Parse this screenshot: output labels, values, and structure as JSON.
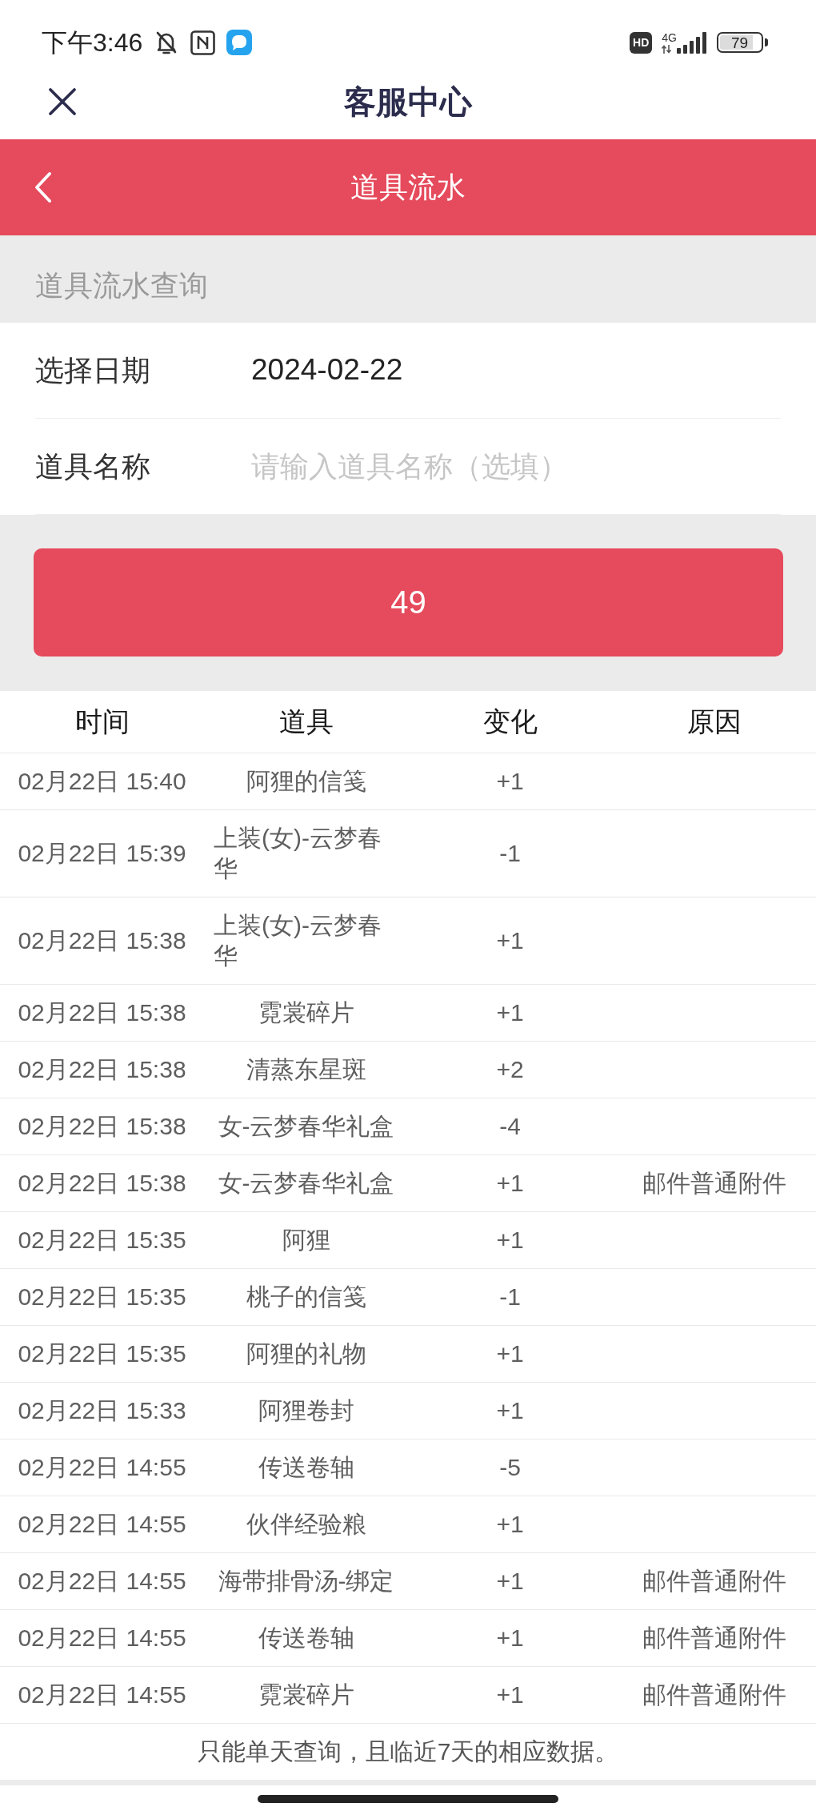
{
  "status_bar": {
    "time": "下午3:46",
    "hd_badge": "HD",
    "network": "4G",
    "battery": "79"
  },
  "nav_bar": {
    "title": "客服中心"
  },
  "header": {
    "title": "道具流水"
  },
  "query": {
    "title": "道具流水查询",
    "fields": [
      {
        "kind": "date",
        "label": "选择日期",
        "value": "2024-02-22"
      },
      {
        "kind": "text",
        "label": "道具名称",
        "placeholder": "请输入道具名称（选填）"
      }
    ],
    "button": "49"
  },
  "table": {
    "columns": [
      "时间",
      "道具",
      "变化",
      "原因"
    ],
    "rows": [
      {
        "time": "02月22日 15:40",
        "item": "阿狸的信笺",
        "change": "+1"
      },
      {
        "time": "02月22日 15:39",
        "item": "上装(女)-云梦春华",
        "change": "-1"
      },
      {
        "time": "02月22日 15:38",
        "item": "上装(女)-云梦春华",
        "change": "+1"
      },
      {
        "time": "02月22日 15:38",
        "item": "霓裳碎片",
        "change": "+1"
      },
      {
        "time": "02月22日 15:38",
        "item": "清蒸东星斑",
        "change": "+2"
      },
      {
        "time": "02月22日 15:38",
        "item": "女-云梦春华礼盒",
        "change": "-4"
      },
      {
        "time": "02月22日 15:38",
        "item": "女-云梦春华礼盒",
        "change": "+1",
        "reason": "邮件普通附件"
      },
      {
        "time": "02月22日 15:35",
        "item": "阿狸",
        "change": "+1"
      },
      {
        "time": "02月22日 15:35",
        "item": "桃子的信笺",
        "change": "-1"
      },
      {
        "time": "02月22日 15:35",
        "item": "阿狸的礼物",
        "change": "+1"
      },
      {
        "time": "02月22日 15:33",
        "item": "阿狸卷封",
        "change": "+1"
      },
      {
        "time": "02月22日 14:55",
        "item": "传送卷轴",
        "change": "-5"
      },
      {
        "time": "02月22日 14:55",
        "item": "伙伴经验粮",
        "change": "+1"
      },
      {
        "time": "02月22日 14:55",
        "item": "海带排骨汤-绑定",
        "change": "+1",
        "reason": "邮件普通附件"
      },
      {
        "time": "02月22日 14:55",
        "item": "传送卷轴",
        "change": "+1",
        "reason": "邮件普通附件"
      },
      {
        "time": "02月22日 14:55",
        "item": "霓裳碎片",
        "change": "+1",
        "reason": "邮件普通附件"
      }
    ]
  },
  "footer_note": "只能单天查询，且临近7天的相应数据。"
}
